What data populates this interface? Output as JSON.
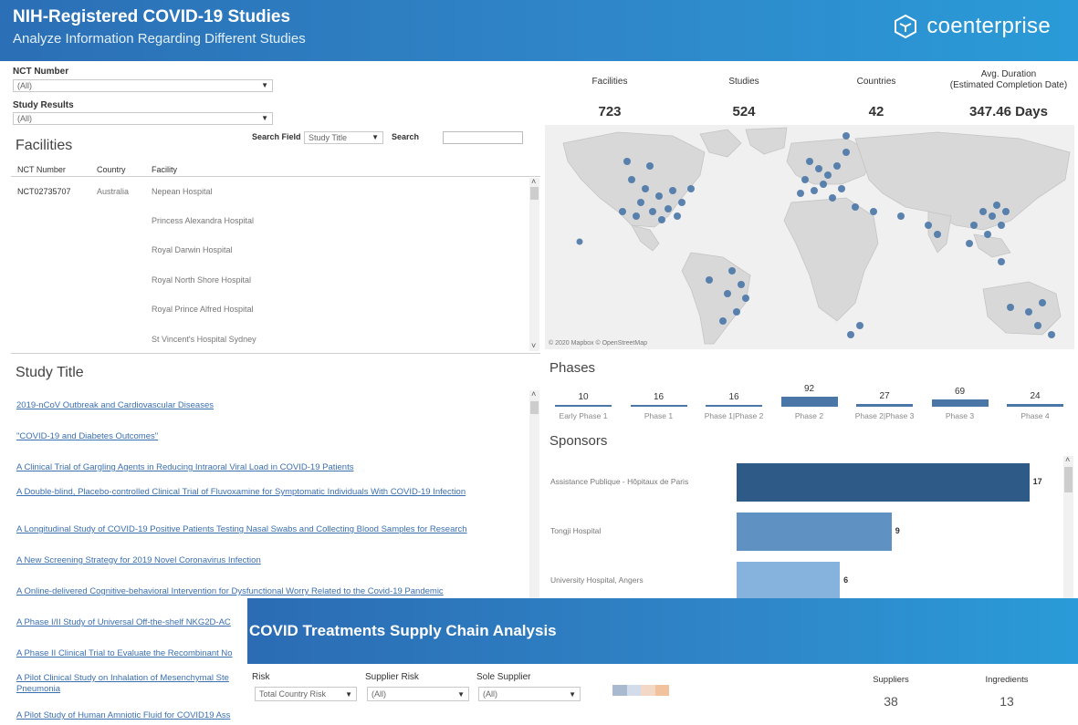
{
  "header": {
    "title": "NIH-Registered COVID-19 Studies",
    "subtitle": "Analyze Information Regarding Different Studies",
    "logo_text": "coenterprise"
  },
  "filters": {
    "nct_label": "NCT Number",
    "nct_value": "(All)",
    "results_label": "Study Results",
    "results_value": "(All)",
    "search_field_label": "Search Field",
    "search_field_value": "Study Title",
    "search_label": "Search",
    "search_value": ""
  },
  "facilities": {
    "title": "Facilities",
    "columns": [
      "NCT Number",
      "Country",
      "Facility"
    ],
    "nct": "NCT02735707",
    "country": "Australia",
    "rows": [
      "Nepean Hospital",
      "Princess Alexandra Hospital",
      "Royal Darwin Hospital",
      "Royal North Shore Hospital",
      "Royal Prince Alfred Hospital",
      "St Vincent's Hospital Sydney"
    ]
  },
  "kpis": [
    {
      "label": "Facilities",
      "value": "723"
    },
    {
      "label": "Studies",
      "value": "524"
    },
    {
      "label": "Countries",
      "value": "42"
    },
    {
      "label": "Avg. Duration\n(Estimated Completion Date)",
      "value": "347.46 Days"
    }
  ],
  "map": {
    "credit": "© 2020 Mapbox © OpenStreetMap"
  },
  "study_title": {
    "title": "Study Title",
    "items": [
      "2019-nCoV Outbreak and Cardiovascular Diseases",
      "\"COVID-19 and Diabetes Outcomes\"",
      "A Clinical Trial of Gargling Agents in Reducing Intraoral Viral Load in COVID-19 Patients",
      "A Double-blind, Placebo-controlled Clinical Trial of Fluvoxamine for Symptomatic Individuals With COVID-19 Infection",
      "A Longitudinal Study of COVID-19 Positive Patients Testing Nasal Swabs and Collecting Blood Samples for Research",
      "A New Screening Strategy for 2019 Novel Coronavirus Infection",
      "A Online-delivered Cognitive-behavioral Intervention for Dysfunctional Worry Related to the Covid-19 Pandemic",
      "A Phase I/II Study of Universal Off-the-shelf NKG2D-AC",
      "A Phase II Clinical Trial to Evaluate the Recombinant No",
      "A Pilot Clinical Study on Inhalation of Mesenchymal Ste Pneumonia",
      "A Pilot Study of Human Amniotic Fluid for COVID19 Ass"
    ]
  },
  "phases": {
    "title": "Phases",
    "color": "#4b77a8"
  },
  "sponsors": {
    "title": "Sponsors"
  },
  "chart_data": [
    {
      "type": "bar",
      "title": "Phases",
      "categories": [
        "Early Phase 1",
        "Phase 1",
        "Phase 1|Phase 2",
        "Phase 2",
        "Phase 2|Phase 3",
        "Phase 3",
        "Phase 4"
      ],
      "values": [
        10,
        16,
        16,
        92,
        27,
        69,
        24
      ]
    },
    {
      "type": "bar",
      "title": "Sponsors",
      "categories": [
        "Assistance Publique - Hôpitaux de Paris",
        "Tongji Hospital",
        "University Hospital, Angers"
      ],
      "values": [
        17,
        9,
        6
      ],
      "colors": [
        "#2e5a87",
        "#5f91c2",
        "#86b3dd"
      ]
    }
  ],
  "overlay": {
    "title": "COVID Treatments Supply Chain Analysis",
    "risk_label": "Risk",
    "risk_value": "Total Country Risk",
    "supplier_risk_label": "Supplier Risk",
    "supplier_risk_value": "(All)",
    "sole_supplier_label": "Sole Supplier",
    "sole_supplier_value": "(All)",
    "suppliers_label": "Suppliers",
    "suppliers_value": "38",
    "ingredients_label": "Ingredients",
    "ingredients_value": "13"
  }
}
